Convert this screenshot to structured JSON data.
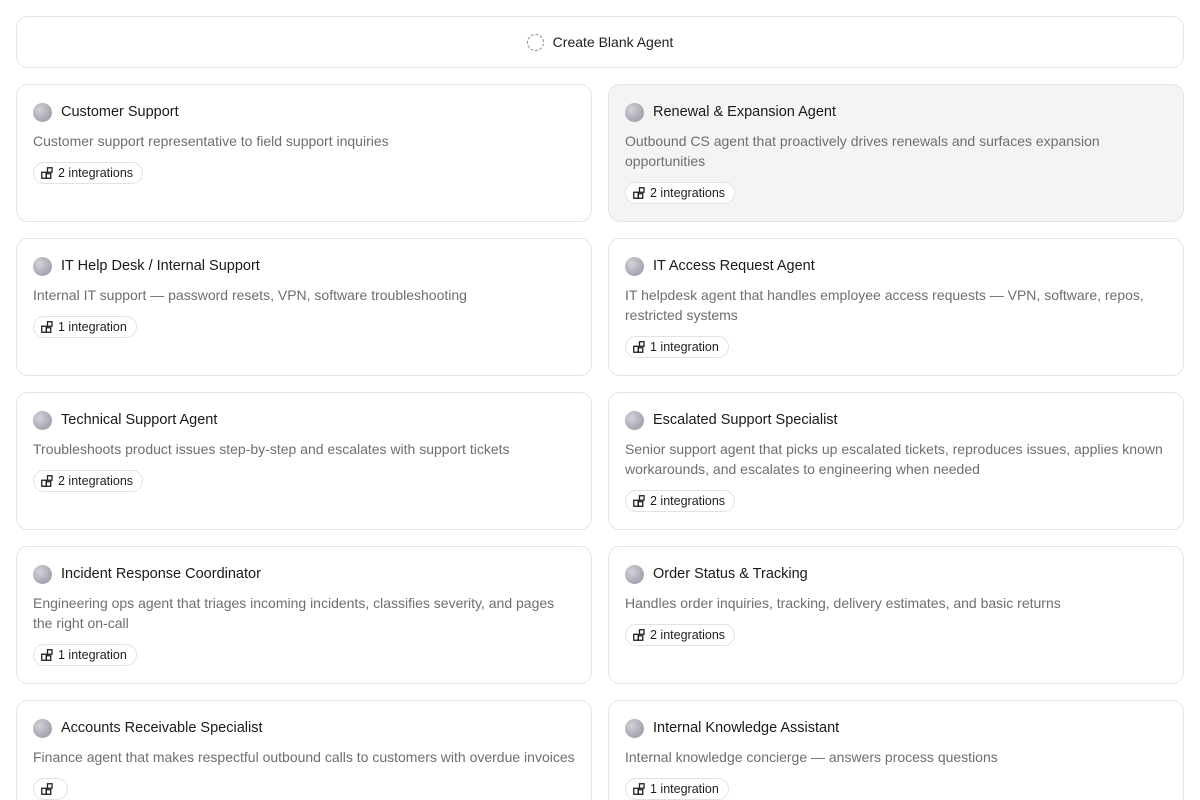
{
  "create_blank": {
    "label": "Create Blank Agent"
  },
  "agents": [
    {
      "title": "Customer Support",
      "description": "Customer support representative to field support inquiries",
      "integrations": "2 integrations"
    },
    {
      "title": "Renewal & Expansion Agent",
      "description": "Outbound CS agent that proactively drives renewals and surfaces expansion opportunities",
      "integrations": "2 integrations"
    },
    {
      "title": "IT Help Desk / Internal Support",
      "description": "Internal IT support — password resets, VPN, software troubleshooting",
      "integrations": "1 integration"
    },
    {
      "title": "IT Access Request Agent",
      "description": "IT helpdesk agent that handles employee access requests — VPN, software, repos, restricted systems",
      "integrations": "1 integration"
    },
    {
      "title": "Technical Support Agent",
      "description": "Troubleshoots product issues step-by-step and escalates with support tickets",
      "integrations": "2 integrations"
    },
    {
      "title": "Escalated Support Specialist",
      "description": "Senior support agent that picks up escalated tickets, reproduces issues, applies known workarounds, and escalates to engineering when needed",
      "integrations": "2 integrations"
    },
    {
      "title": "Incident Response Coordinator",
      "description": "Engineering ops agent that triages incoming incidents, classifies severity, and pages the right on-call",
      "integrations": "1 integration"
    },
    {
      "title": "Order Status & Tracking",
      "description": "Handles order inquiries, tracking, delivery estimates, and basic returns",
      "integrations": "2 integrations"
    },
    {
      "title": "Accounts Receivable Specialist",
      "description": "Finance agent that makes respectful outbound calls to customers with overdue invoices",
      "integrations": ""
    },
    {
      "title": "Internal Knowledge Assistant",
      "description": "Internal knowledge concierge — answers process questions",
      "integrations": "1 integration"
    }
  ]
}
